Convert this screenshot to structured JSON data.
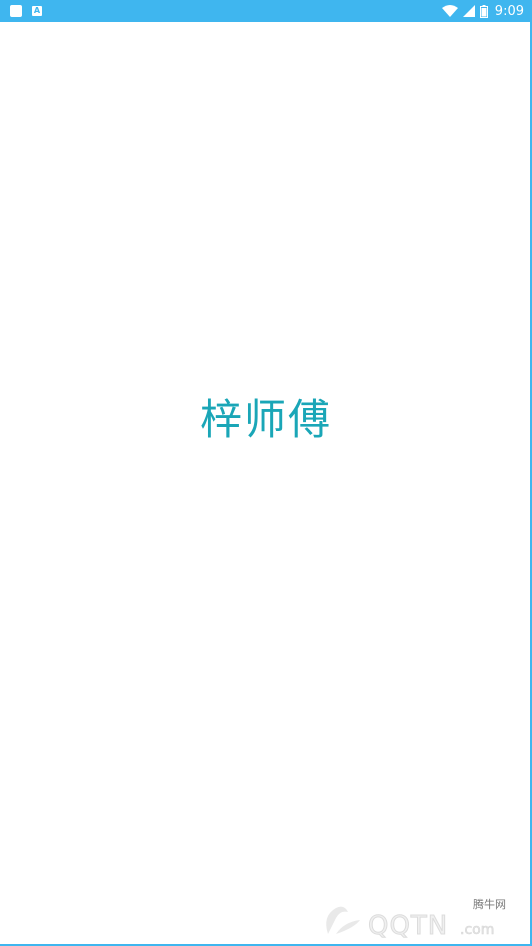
{
  "status_bar": {
    "time": "9:09",
    "notification_icons": [
      "square-notification-icon",
      "a-notification-icon"
    ],
    "status_icons": [
      "wifi-icon",
      "cell-signal-icon",
      "battery-icon"
    ],
    "notif_a_label": "A",
    "background_color": "#3fb6ef"
  },
  "splash": {
    "app_name": "梓师傅",
    "text_color": "#1aa6b7"
  },
  "watermark": {
    "site_name_cn": "腾牛网",
    "site_domain": "QQTN.com"
  }
}
